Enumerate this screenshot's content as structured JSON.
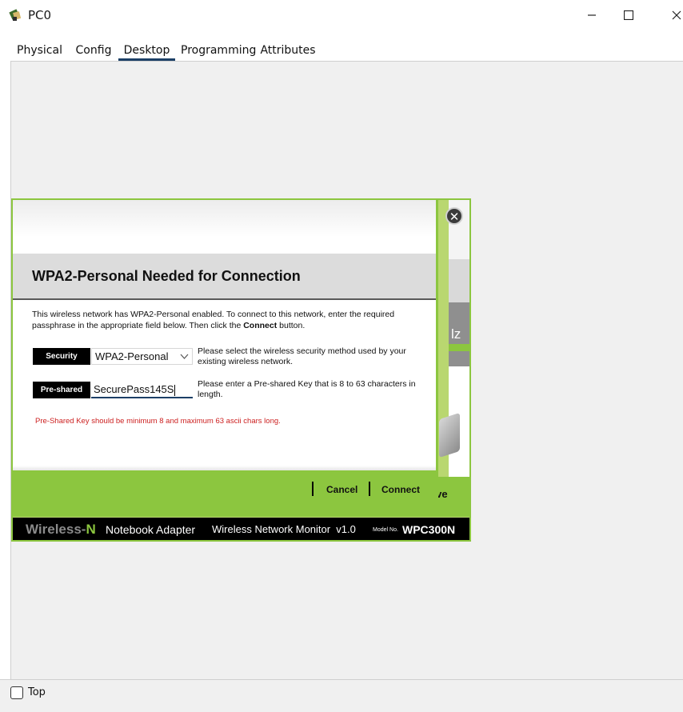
{
  "window": {
    "title": "PC0",
    "icon": "cisco-pc-icon"
  },
  "window_controls": {
    "minimize": "—",
    "maximize": "☐",
    "close": "✕"
  },
  "tabs": [
    {
      "label": "Physical"
    },
    {
      "label": "Config"
    },
    {
      "label": "Desktop"
    },
    {
      "label": "Programming"
    },
    {
      "label": "Attributes"
    }
  ],
  "active_tab": "Desktop",
  "footer": {
    "top_checkbox_label": "Top",
    "top_checked": false
  },
  "monitor": {
    "brand_word": "Wireless-",
    "brand_letter": "N",
    "product": "Notebook Adapter",
    "app_name": "Wireless Network Monitor  v1.0",
    "model_label": "Model No.",
    "model_value": "WPC300N",
    "close_glyph": "✕",
    "partial_text_right": "lz",
    "partial_active": "ctive",
    "colors": {
      "accent_green": "#8cc63f",
      "footer_black": "#000000"
    }
  },
  "dialog": {
    "title": "WPA2-Personal Needed for Connection",
    "desc_part1": "This wireless network has WPA2-Personal enabled. To connect to this network, enter the required passphrase in the appropriate field below. Then click the ",
    "desc_bold": "Connect",
    "desc_part2": " button.",
    "security": {
      "label": "Security",
      "value": "WPA2-Personal",
      "help": "Please select the wireless security method used by your existing wireless network."
    },
    "preshared_key": {
      "label": "Pre-shared Key",
      "value": "SecurePass145S",
      "help": "Please enter a Pre-shared Key that is 8 to 63 characters in length."
    },
    "error": "Pre-Shared Key should be minimum 8 and maximum 63 ascii chars long.",
    "buttons": {
      "cancel": "Cancel",
      "connect": "Connect"
    },
    "colors": {
      "error_red": "#cc1f1f"
    }
  }
}
